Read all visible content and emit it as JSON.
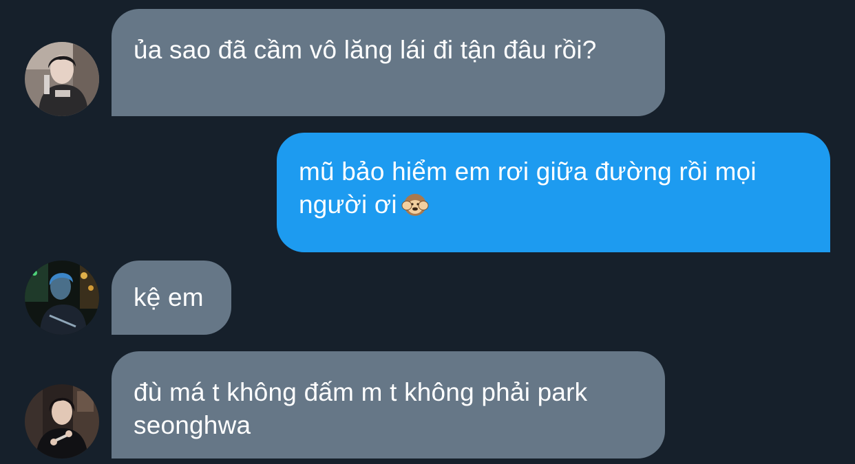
{
  "messages": [
    {
      "sender": "other",
      "avatar_icon": "avatar-photo-icon",
      "text": "ủa sao đã cầm vô lăng lái đi tận đâu rồi?"
    },
    {
      "sender": "me",
      "text": "mũ bảo hiểm em rơi giữa đường rồi mọi người ơi",
      "emoji_icon": "hear-no-evil-monkey-icon"
    },
    {
      "sender": "other",
      "avatar_icon": "avatar-photo-icon",
      "text": "kệ em"
    },
    {
      "sender": "other",
      "avatar_icon": "avatar-photo-icon",
      "text": "đù má t không đấm m t không phải park seonghwa"
    }
  ],
  "colors": {
    "background": "#16202b",
    "incoming_bubble": "#667787",
    "outgoing_bubble": "#1d9bf0",
    "text": "#ffffff"
  }
}
